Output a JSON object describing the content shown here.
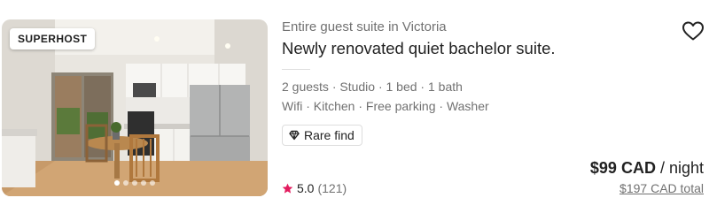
{
  "listing": {
    "badge": "SUPERHOST",
    "subtitle": "Entire guest suite in Victoria",
    "title": "Newly renovated quiet bachelor suite.",
    "details": "2 guests · Studio · 1 bed · 1 bath",
    "amenities": "Wifi · Kitchen · Free parking · Washer",
    "highlight": {
      "icon": "diamond-icon",
      "label": "Rare find"
    },
    "rating": {
      "icon": "star-icon",
      "value": "5.0",
      "count": "(121)",
      "color": "#e31c5f"
    },
    "price": {
      "amount": "$99 CAD",
      "unit": "/ night",
      "total": "$197 CAD total"
    },
    "wishlist_icon": "heart-icon",
    "photo": {
      "description_icon": "listing-photo",
      "dots_total": 5,
      "dots_active": 0
    }
  }
}
